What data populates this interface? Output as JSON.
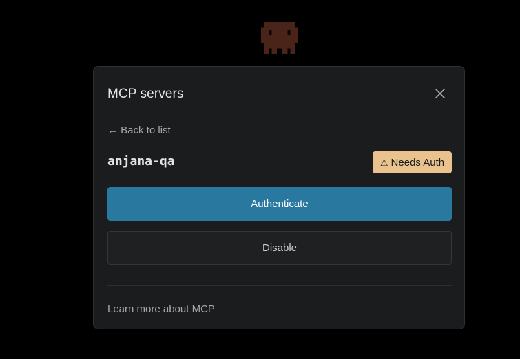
{
  "mascot": {
    "icon": "pixel-creature-icon",
    "color": "#4a2319"
  },
  "dialog": {
    "title": "MCP servers",
    "close_icon": "close-icon",
    "back_link": "← Back to list",
    "server": {
      "name": "anjana-qa",
      "status_icon": "warning-icon",
      "status_glyph": "⚠",
      "status_label": "Needs Auth",
      "status_color": "#e9c28d"
    },
    "actions": {
      "authenticate_label": "Authenticate",
      "disable_label": "Disable"
    },
    "footer_link": "Learn more about MCP"
  },
  "colors": {
    "background": "#000000",
    "dialog_bg": "#1b1c1e",
    "primary_button": "#2878a0"
  }
}
